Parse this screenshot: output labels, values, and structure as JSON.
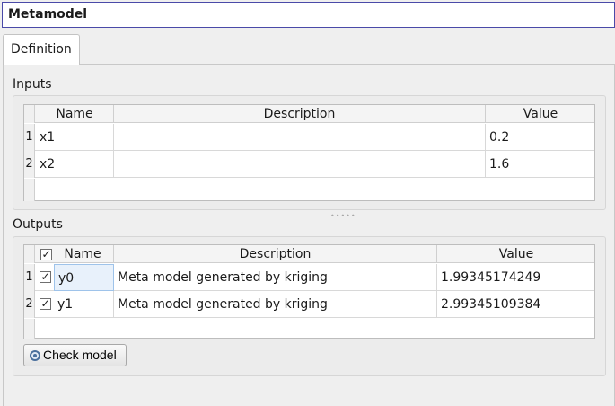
{
  "window": {
    "title": "Metamodel"
  },
  "tabs": [
    {
      "label": "Definition"
    }
  ],
  "inputs": {
    "title": "Inputs",
    "columns": [
      "Name",
      "Description",
      "Value"
    ],
    "rows": [
      {
        "index": "1",
        "name": "x1",
        "description": "",
        "value": "0.2"
      },
      {
        "index": "2",
        "name": "x2",
        "description": "",
        "value": "1.6"
      }
    ]
  },
  "outputs": {
    "title": "Outputs",
    "columns": [
      "Name",
      "Description",
      "Value"
    ],
    "header_checked": true,
    "rows": [
      {
        "index": "1",
        "checked": true,
        "name": "y0",
        "description": "Meta model generated by kriging",
        "value": "1.99345174249"
      },
      {
        "index": "2",
        "checked": true,
        "name": "y1",
        "description": "Meta model generated by kriging",
        "value": "2.99345109384"
      }
    ]
  },
  "check_button": {
    "label": "Check model",
    "icon": "gear-icon"
  },
  "colors": {
    "title_border": "#4a4aa8",
    "selection": "#e8f1fb"
  }
}
